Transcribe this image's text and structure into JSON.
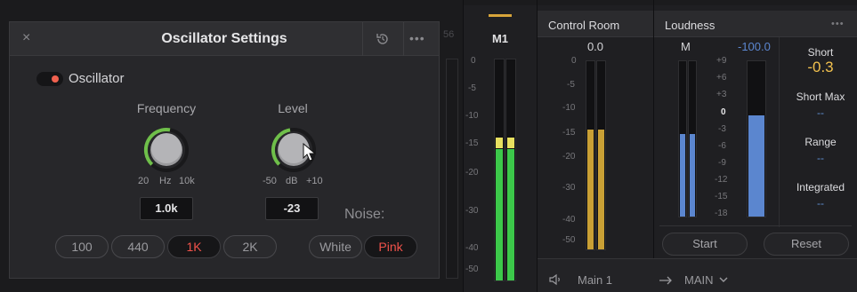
{
  "oscillator_panel": {
    "title": "Oscillator Settings",
    "close_glyph": "×",
    "more_glyph": "•••",
    "toggle_label": "Oscillator",
    "toggle_on": true,
    "frequency": {
      "title": "Frequency",
      "scale_min": "20",
      "scale_unit": "Hz",
      "scale_max": "10k",
      "value": "1.0k"
    },
    "level": {
      "title": "Level",
      "scale_min": "-50",
      "scale_unit": "dB",
      "scale_max": "+10",
      "value": "-23"
    },
    "noise_label": "Noise:",
    "frequency_presets": [
      "100",
      "440",
      "1K",
      "2K"
    ],
    "active_frequency_preset": "1K",
    "noise_presets": [
      "White",
      "Pink"
    ],
    "active_noise_preset": "Pink",
    "background_number": "56"
  },
  "m1_meter": {
    "label": "M1",
    "ticks": [
      "0",
      "-5",
      "-10",
      "-15",
      "-20",
      "-30",
      "-40",
      "-50"
    ]
  },
  "control_room": {
    "title": "Control Room",
    "peak_value": "0.0",
    "ticks": [
      "0",
      "-5",
      "-10",
      "-15",
      "-20",
      "-30",
      "-40",
      "-50"
    ]
  },
  "loudness": {
    "title": "Loudness",
    "more_glyph": "•••",
    "meter_label": "M",
    "scale_value": "-100.0",
    "ticks": [
      "+9",
      "+6",
      "+3",
      "0",
      "-3",
      "-6",
      "-9",
      "-12",
      "-15",
      "-18"
    ],
    "stats": {
      "short_label": "Short",
      "short_value": "-0.3",
      "short_max_label": "Short Max",
      "short_max_value": "--",
      "range_label": "Range",
      "range_value": "--",
      "integrated_label": "Integrated",
      "integrated_value": "--"
    },
    "start_label": "Start",
    "reset_label": "Reset"
  },
  "bottom_bar": {
    "output_name": "Main 1",
    "bus_name": "MAIN"
  },
  "colors": {
    "accent_red": "#f0524a",
    "meter_green": "#3cc84a",
    "meter_yellow": "#e8e060",
    "meter_gold": "#c9a035",
    "meter_blue": "#5b86cf",
    "stat_gold": "#f2c14e",
    "stat_blue": "#5f8fd3"
  }
}
